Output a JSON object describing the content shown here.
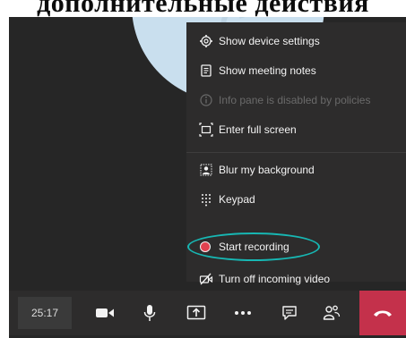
{
  "header": {
    "text": "дополнительные действия"
  },
  "menu": {
    "items": [
      {
        "label": "Show device settings",
        "icon": "gear-icon"
      },
      {
        "label": "Show meeting notes",
        "icon": "notes-icon"
      },
      {
        "label": "Info pane is disabled by policies",
        "icon": "info-icon",
        "disabled": true
      },
      {
        "label": "Enter full screen",
        "icon": "fullscreen-icon"
      },
      {
        "label": "Blur my background",
        "icon": "blur-background-icon"
      },
      {
        "label": "Keypad",
        "icon": "keypad-icon"
      },
      {
        "label": "Start recording",
        "icon": "record-icon",
        "highlighted": true
      },
      {
        "label": "Turn off incoming video",
        "icon": "video-off-icon"
      }
    ]
  },
  "toolbar": {
    "timer": "25:17",
    "buttons": [
      "camera-icon",
      "microphone-icon",
      "share-screen-icon",
      "more-actions-icon",
      "chat-icon",
      "participants-icon",
      "hang-up-icon"
    ]
  },
  "colors": {
    "background": "#262626",
    "menu": "#2d2c2c",
    "highlight": "#17b7b3",
    "record": "#e0414f",
    "hangup": "#c4314b"
  }
}
